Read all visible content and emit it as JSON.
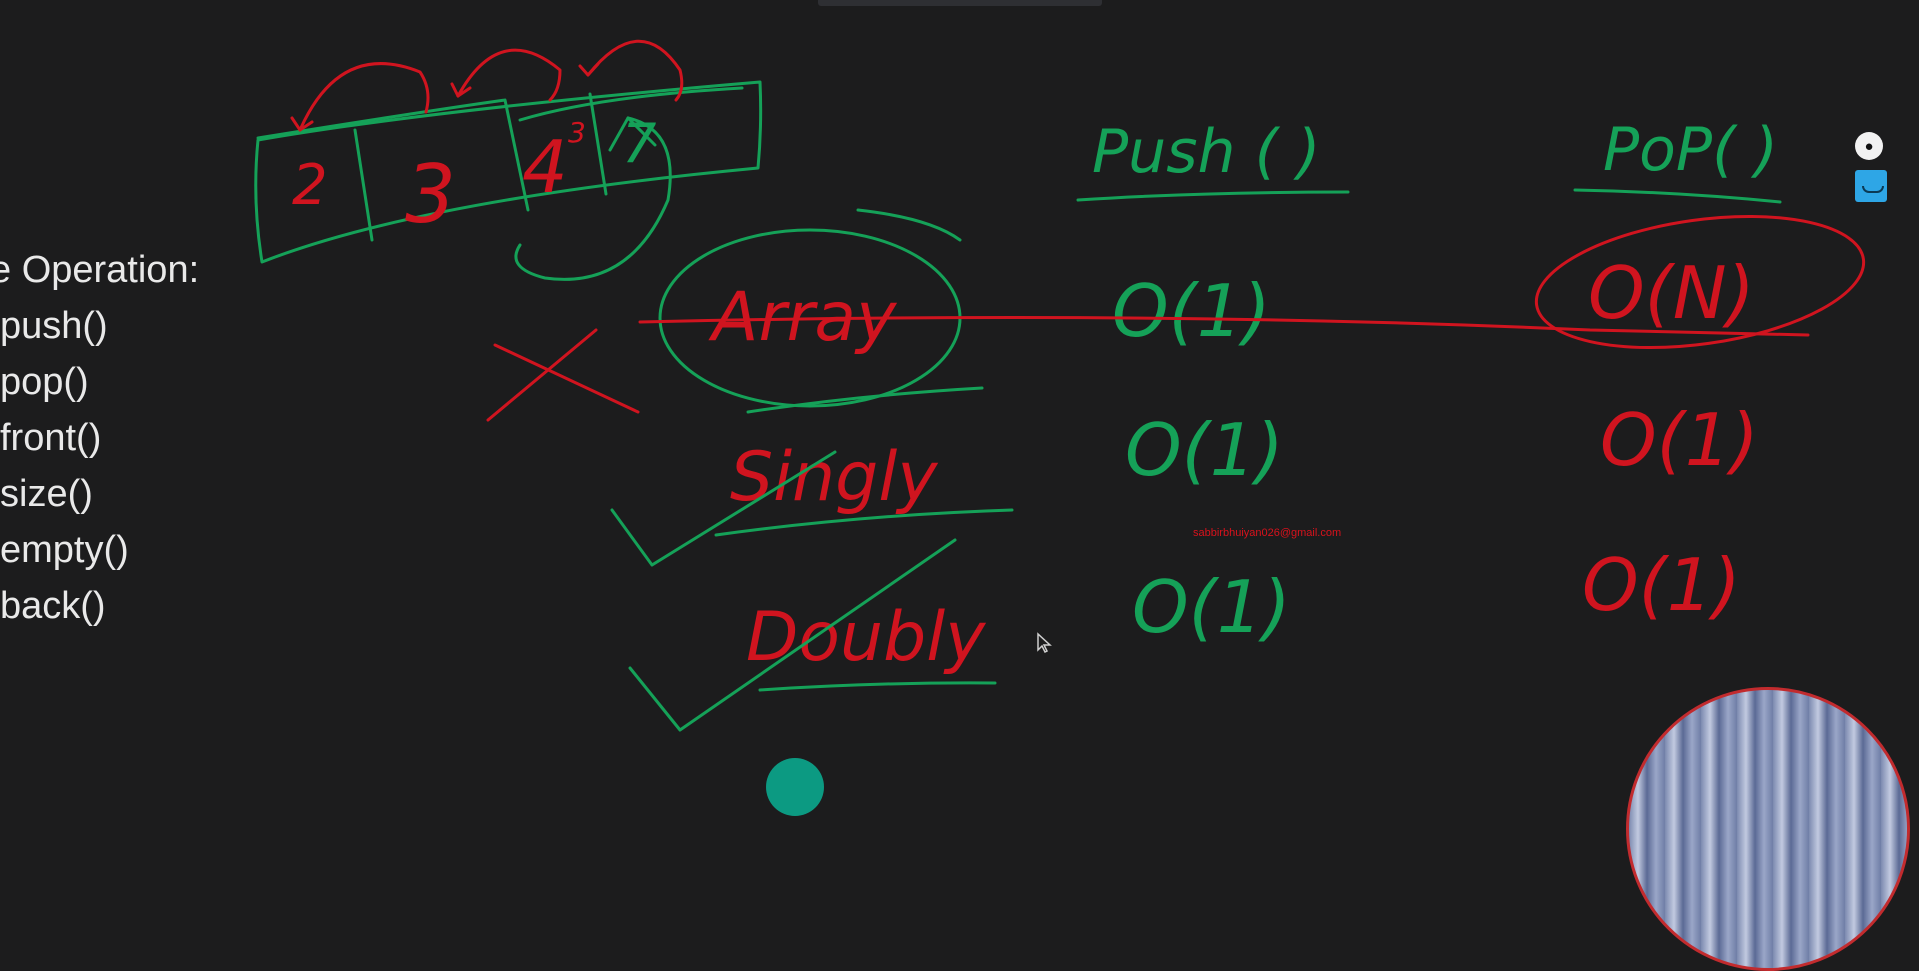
{
  "operations": {
    "title": "e Operation:",
    "items": [
      "push()",
      "pop()",
      "front()",
      "size()",
      "empty()",
      "back()"
    ]
  },
  "whiteboard": {
    "boxes": [
      "2",
      "3",
      "4",
      "7"
    ],
    "box_superscript": "3",
    "columns": [
      "Push ( )",
      "PoP( )"
    ],
    "rows": [
      {
        "label": "Array",
        "push": "O(1)",
        "pop": "O(N)"
      },
      {
        "label": "Singly",
        "push": "O(1)",
        "pop": "O(1)"
      },
      {
        "label": "Doubly",
        "push": "O(1)",
        "pop": "O(1)"
      }
    ]
  },
  "watermark": "sabbirbhuiyan026@gmail.com",
  "colors": {
    "green_ink": "#15a158",
    "red_ink": "#d0141f",
    "background": "#1c1c1d",
    "text": "#e9e9e9"
  },
  "tools": [
    "pen-icon",
    "whiteboard-icon"
  ]
}
